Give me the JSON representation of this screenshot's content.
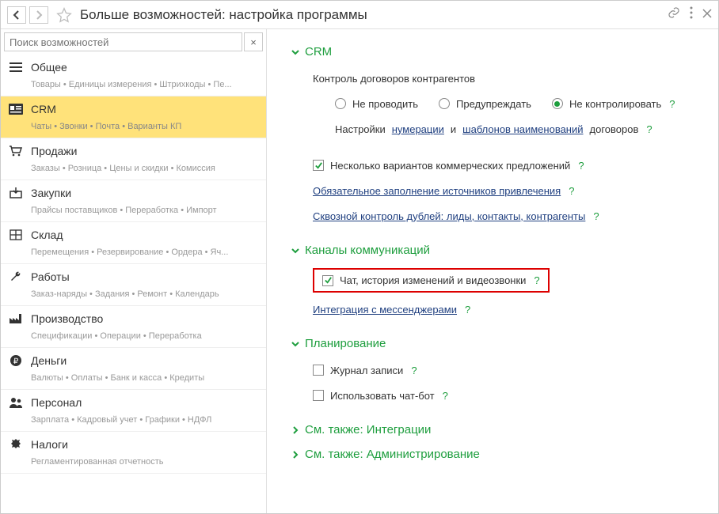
{
  "title": "Больше возможностей: настройка программы",
  "search": {
    "placeholder": "Поиск возможностей"
  },
  "sidebar": [
    {
      "label": "Общее",
      "sub": "Товары • Единицы измерения • Штрихкоды • Пе...",
      "icon": "menu"
    },
    {
      "label": "CRM",
      "sub": "Чаты • Звонки • Почта • Варианты КП",
      "icon": "idcard",
      "active": true
    },
    {
      "label": "Продажи",
      "sub": "Заказы • Розница • Цены и скидки • Комиссия",
      "icon": "cart"
    },
    {
      "label": "Закупки",
      "sub": "Прайсы поставщиков • Переработка • Импорт",
      "icon": "box-in"
    },
    {
      "label": "Склад",
      "sub": "Перемещения • Резервирование • Ордера • Яч...",
      "icon": "shelves"
    },
    {
      "label": "Работы",
      "sub": "Заказ-наряды • Задания • Ремонт • Календарь",
      "icon": "wrench"
    },
    {
      "label": "Производство",
      "sub": "Спецификации • Операции • Переработка",
      "icon": "factory"
    },
    {
      "label": "Деньги",
      "sub": "Валюты • Оплаты • Банк и касса • Кредиты",
      "icon": "ruble"
    },
    {
      "label": "Персонал",
      "sub": "Зарплата • Кадровый учет • Графики • НДФЛ",
      "icon": "people"
    },
    {
      "label": "Налоги",
      "sub": "Регламентированная отчетность",
      "icon": "emblem"
    }
  ],
  "crm": {
    "head": "CRM",
    "contracts_label": "Контроль договоров контрагентов",
    "radios": {
      "r1": "Не проводить",
      "r2": "Предупреждать",
      "r3": "Не контролировать"
    },
    "numbering_prefix": "Настройки",
    "numbering_link": "нумерации",
    "and": "и",
    "templates_link": "шаблонов наименований",
    "numbering_suffix": "договоров",
    "opt_offers": "Несколько вариантов коммерческих предложений",
    "link_sources": "Обязательное заполнение источников привлечения",
    "link_dedup": "Сквозной контроль дублей: лиды, контакты, контрагенты"
  },
  "channels": {
    "head": "Каналы коммуникаций",
    "opt_chat": "Чат, история изменений и видеозвонки",
    "link_messengers": "Интеграция с мессенджерами"
  },
  "planning": {
    "head": "Планирование",
    "opt_journal": "Журнал записи",
    "opt_bot": "Использовать чат-бот"
  },
  "also1": "См. также: Интеграции",
  "also2": "См. также: Администрирование",
  "help": "?"
}
